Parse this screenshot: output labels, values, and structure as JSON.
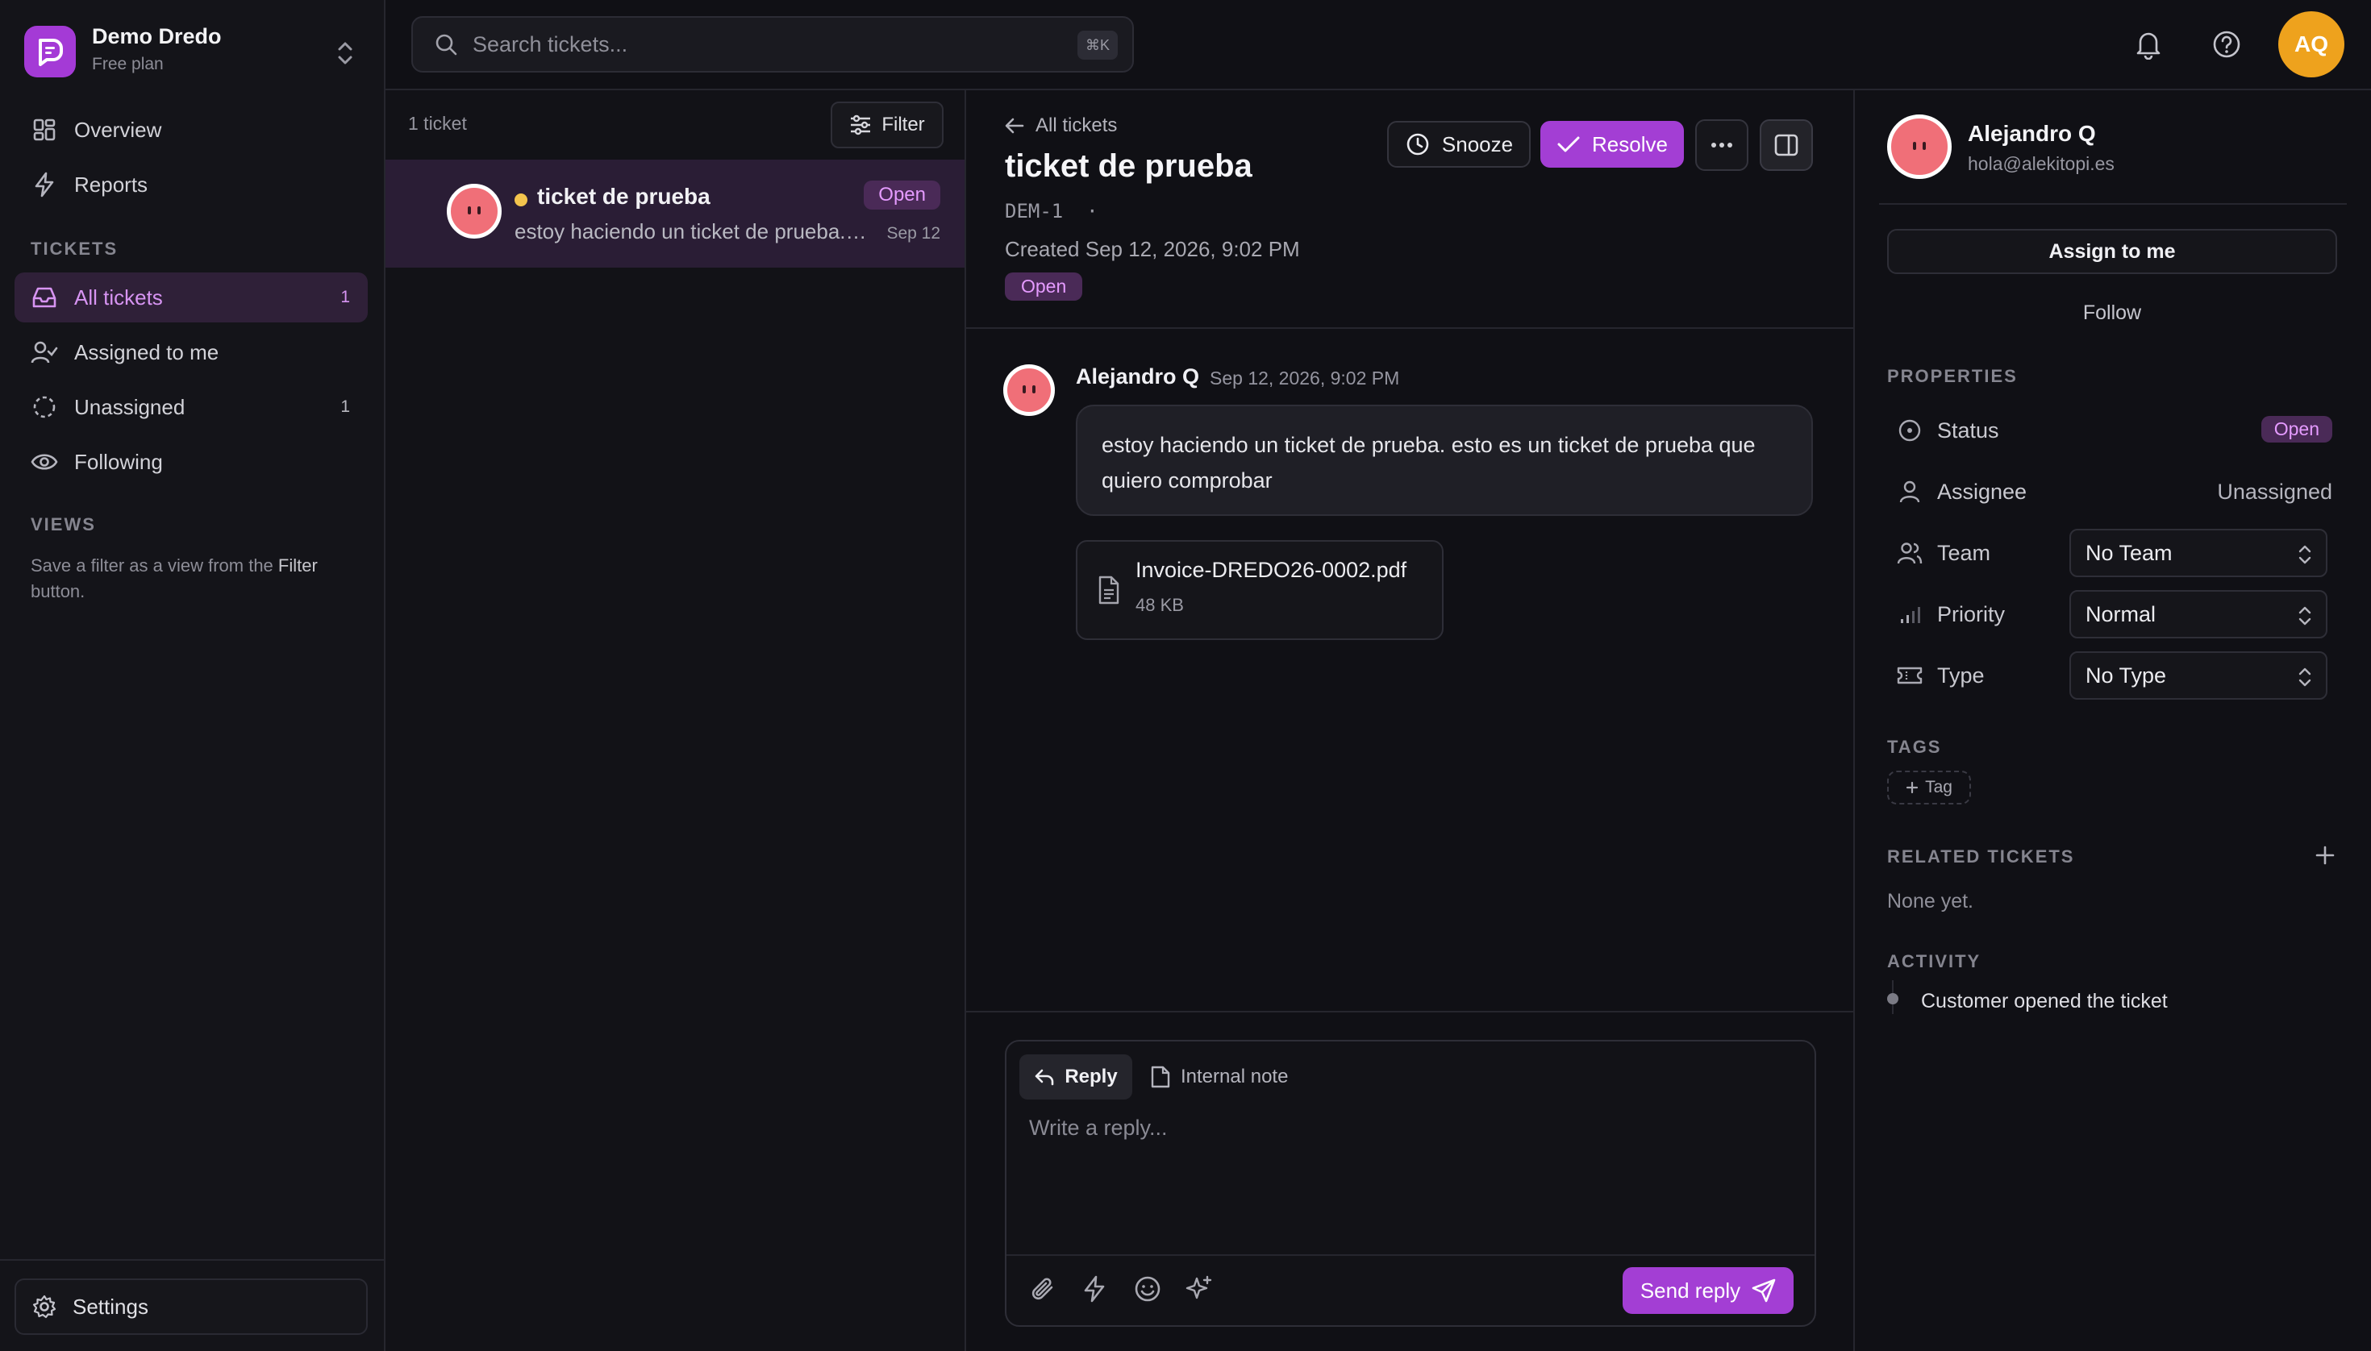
{
  "workspace": {
    "name": "Demo Dredo",
    "plan": "Free plan"
  },
  "sidebar": {
    "nav": [
      {
        "label": "Overview",
        "icon": "grid-icon"
      },
      {
        "label": "Reports",
        "icon": "bolt-icon"
      }
    ],
    "tickets_label": "TICKETS",
    "tickets": [
      {
        "label": "All tickets",
        "count": "1",
        "active": true
      },
      {
        "label": "Assigned to me",
        "count": ""
      },
      {
        "label": "Unassigned",
        "count": "1"
      },
      {
        "label": "Following",
        "count": ""
      }
    ],
    "views_label": "VIEWS",
    "views_hint_prefix": "Save a filter as a view from the ",
    "views_hint_bold": "Filter",
    "views_hint_suffix": " button.",
    "settings_label": "Settings"
  },
  "topbar": {
    "search_placeholder": "Search tickets...",
    "search_shortcut": "⌘K",
    "user_initials": "AQ"
  },
  "ticket_list": {
    "count_label": "1 ticket",
    "filter_label": "Filter",
    "items": [
      {
        "title": "ticket de prueba",
        "snippet": "estoy haciendo un ticket de prueba. esto es un ticket de prueba que quiero comprobar",
        "status": "Open",
        "date": "Sep 12"
      }
    ]
  },
  "conversation": {
    "back_label": "All tickets",
    "title": "ticket de prueba",
    "ticket_id": "DEM-1",
    "id_separator": "·",
    "created": "Created Sep 12, 2026, 9:02 PM",
    "status": "Open",
    "snooze_label": "Snooze",
    "resolve_label": "Resolve",
    "message": {
      "author": "Alejandro Q",
      "time": "Sep 12, 2026, 9:02 PM",
      "body": "estoy haciendo un ticket de prueba. esto es un ticket de prueba que quiero comprobar",
      "attachment": {
        "name": "Invoice-DREDO26-0002.pdf",
        "size": "48 KB"
      }
    },
    "composer": {
      "reply_tab": "Reply",
      "note_tab": "Internal note",
      "placeholder": "Write a reply...",
      "send_label": "Send reply"
    }
  },
  "details": {
    "customer": {
      "name": "Alejandro Q",
      "email": "hola@alekitopi.es"
    },
    "assign_label": "Assign to me",
    "follow_label": "Follow",
    "properties_label": "PROPERTIES",
    "status_label": "Status",
    "status_value": "Open",
    "assignee_label": "Assignee",
    "assignee_value": "Unassigned",
    "team_label": "Team",
    "team_value": "No Team",
    "priority_label": "Priority",
    "priority_value": "Normal",
    "type_label": "Type",
    "type_value": "No Type",
    "tags_label": "TAGS",
    "tag_button": "Tag",
    "related_label": "RELATED TICKETS",
    "related_empty": "None yet.",
    "activity_label": "ACTIVITY",
    "activity_item": "Customer opened the ticket"
  },
  "colors": {
    "accent": "#a33ed4",
    "accent_text": "#d794f2",
    "open_badge_bg": "#4a2a57",
    "avatar_orange": "#eea21d",
    "face_pink": "#f06f78",
    "unread_dot": "#f3c44d"
  }
}
